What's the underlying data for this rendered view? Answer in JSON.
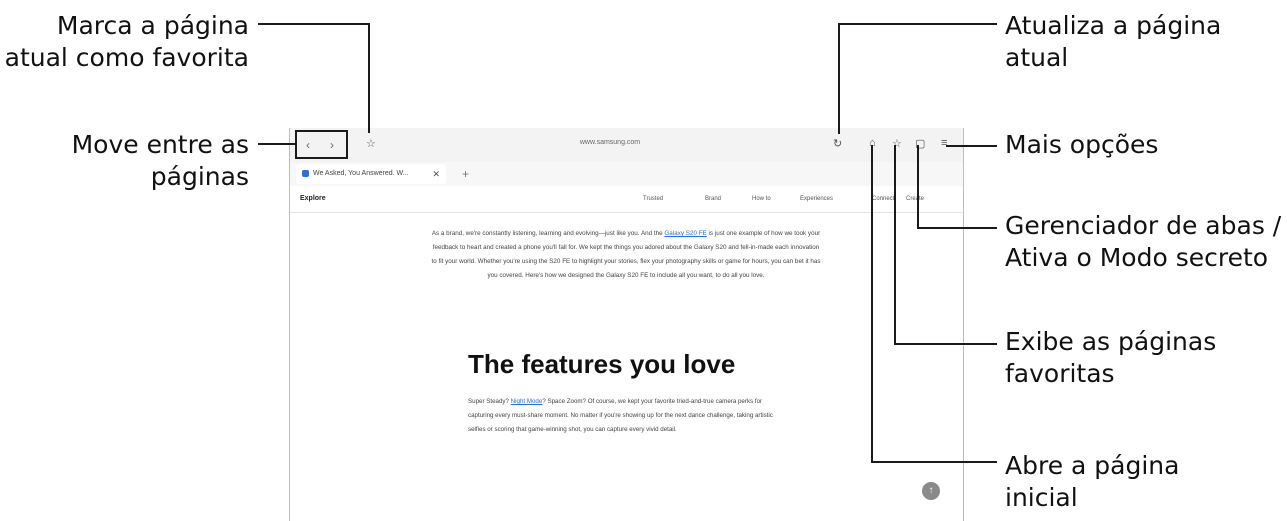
{
  "callouts": {
    "bookmark_page": [
      "Marca a página",
      "atual como favorita"
    ],
    "move_pages": [
      "Move entre as",
      "páginas"
    ],
    "refresh": [
      "Atualiza a página",
      "atual"
    ],
    "more_options": [
      "Mais opções"
    ],
    "tab_manager": [
      "Gerenciador de abas /",
      "Ativa o Modo secreto"
    ],
    "bookmarks": [
      "Exibe as páginas",
      "favoritas"
    ],
    "home": [
      "Abre a página",
      "inicial"
    ]
  },
  "browser": {
    "url": "www.samsung.com",
    "tab_title": "We Asked, You Answered. W...",
    "site_title": "Explore",
    "nav": [
      "Trusted",
      "Brand",
      "How to",
      "Experiences",
      "Connect",
      "Create"
    ],
    "intro_before_link": "As a brand, we're constantly listening, learning and evolving—just like you. And the ",
    "intro_link": "Galaxy S20 FE",
    "intro_after_link": " is just one example of how we took your feedback to heart and created a phone you'll fall for. We kept the things you adored about the Galaxy S20 and fell-in-made each innovation to fit your world. Whether you're using the S20 FE to highlight your stories, flex your photography skills or game for hours, you can bet it has you covered. Here's how we designed the Galaxy S20 FE to include all you want, to do all you love.",
    "heading": "The features you love",
    "body_before_link": "Super Steady? ",
    "body_link": "Night Mode",
    "body_after_link": "? Space Zoom? Of course, we kept your favorite tried-and-true camera perks for capturing every must-share moment. No matter if you're showing up for the next dance challenge, taking artistic selfies or scoring that game-winning shot, you can capture every vivid detail."
  }
}
